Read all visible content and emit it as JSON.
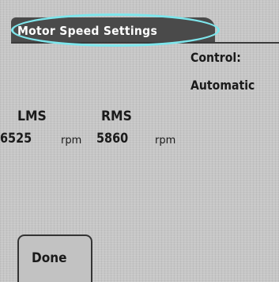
{
  "window": {
    "title": "Motor Speed Settings"
  },
  "control": {
    "label": "Control:",
    "value": "Automatic"
  },
  "motors": {
    "lms": {
      "label": "LMS",
      "value": "6525",
      "unit": "rpm"
    },
    "rms": {
      "label": "RMS",
      "value": "5860",
      "unit": "rpm"
    }
  },
  "buttons": {
    "done": "Done"
  },
  "colors": {
    "background": "#c6c6c6",
    "title_tab": "#4a4a4a",
    "title_text": "#ffffff",
    "highlight_ring": "#7ee6ec"
  }
}
